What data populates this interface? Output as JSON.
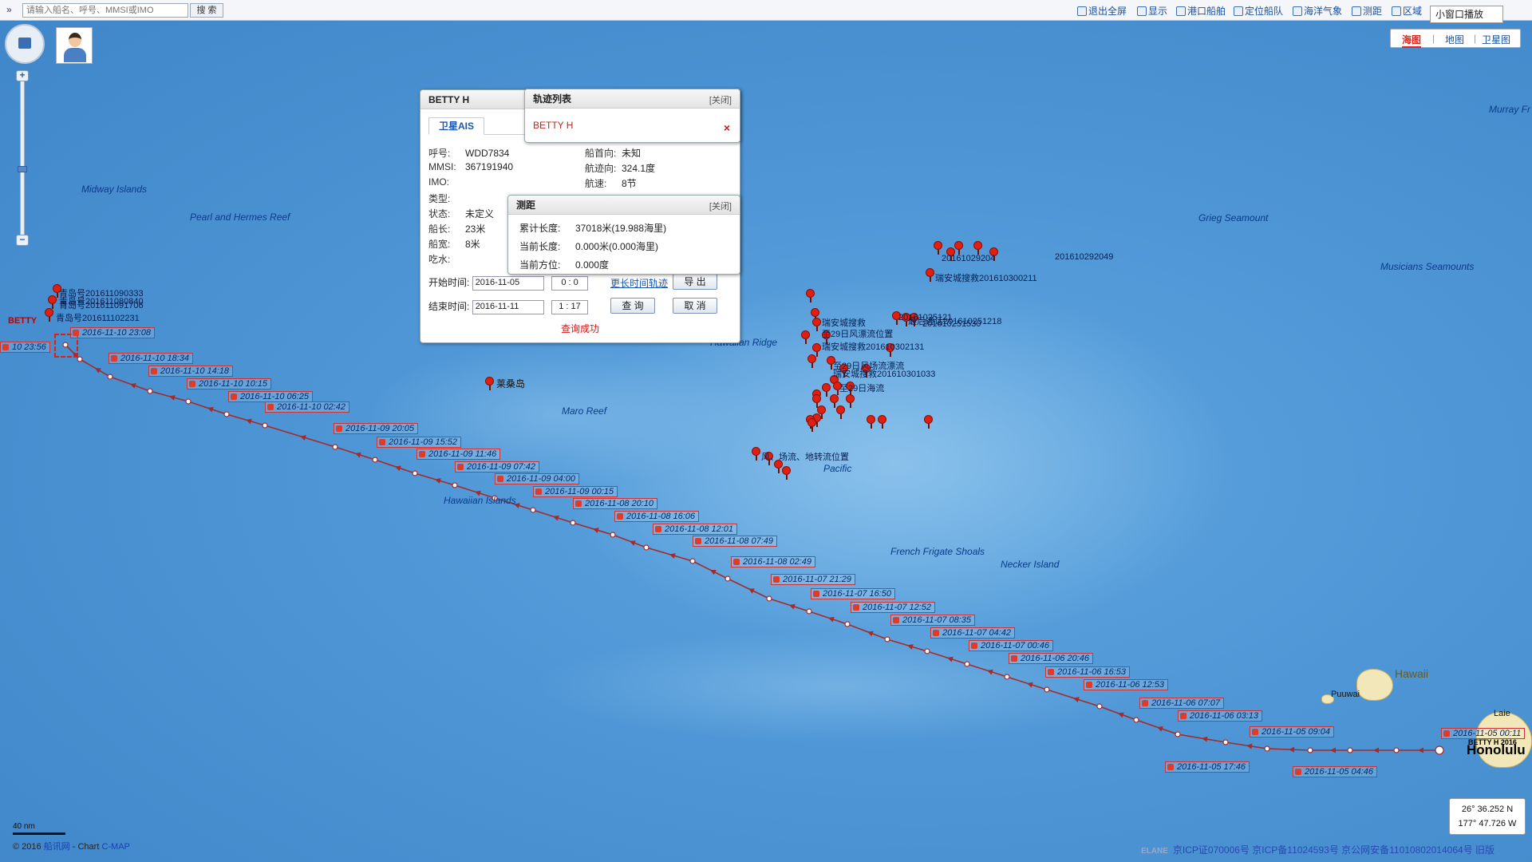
{
  "search": {
    "placeholder": "请输入船名、呼号、MMSI或IMO",
    "button": "搜 索",
    "collapse": "»"
  },
  "toolbar": [
    {
      "label": "退出全屏",
      "icon": "fullscreen-exit-icon"
    },
    {
      "label": "显示",
      "icon": "filter-icon"
    },
    {
      "label": "港口船舶",
      "icon": "port-icon"
    },
    {
      "label": "定位船队",
      "icon": "fleet-icon"
    },
    {
      "label": "海洋气象",
      "icon": "weather-icon"
    },
    {
      "label": "测距",
      "icon": "ruler-icon"
    },
    {
      "label": "区域",
      "icon": "area-icon"
    }
  ],
  "mini_window": "小窗口播放",
  "map_types": [
    "海图",
    "地图",
    "卫星图"
  ],
  "map_type_active": "海图",
  "colors": {
    "track": "#a52a2a",
    "pin": "#e01f10",
    "active_tab": "#e0261a",
    "link": "#1a55b0"
  },
  "places": [
    "Midway Islands",
    "Pearl and Hermes Reef",
    "Hawaiian Ridge",
    "Maro Reef",
    "Hawaiian Islands",
    "French Frigate Shoals",
    "Necker Island",
    "Grieg Seamount",
    "Musicians Seamounts",
    "Murray Fr",
    "Hawaii",
    "Puuwai",
    "Laie",
    "Honolulu",
    "莱桑岛",
    "Pacific"
  ],
  "ship_labels": {
    "start": "BETTY",
    "end": "BETTY H 2016"
  },
  "track_times": [
    "2016-11-10 23:08",
    "2016-11-10 18:34",
    "2016-11-10 14:18",
    "2016-11-10 10:15",
    "2016-11-10 06:25",
    "2016-11-10 02:42",
    "2016-11-09 20:05",
    "2016-11-09 15:52",
    "2016-11-09 11:46",
    "2016-11-09 07:42",
    "2016-11-09 04:00",
    "2016-11-09 00:15",
    "2016-11-08 20:10",
    "2016-11-08 16:06",
    "2016-11-08 12:01",
    "2016-11-08 07:49",
    "2016-11-08 02:49",
    "2016-11-07 21:29",
    "2016-11-07 16:50",
    "2016-11-07 12:52",
    "2016-11-07 08:35",
    "2016-11-07 04:42",
    "2016-11-07 00:46",
    "2016-11-06 20:46",
    "2016-11-06 16:53",
    "2016-11-06 12:53",
    "2016-11-06 07:07",
    "2016-11-06 03:13",
    "2016-11-05 09:04",
    "2016-11-05 17:46",
    "2016-11-05 04:46",
    "2016-11-05 00:11",
    "10 23:56"
  ],
  "pin_labels": {
    "west": [
      "青岛号201611090333",
      "青岛号201611091706",
      "青岛号201611102231",
      "青岛号201611080840"
    ],
    "north": [
      "瑞安城搜救201610300211",
      "20161029204",
      "瑞安城搜救",
      "20161025121",
      "至29日风漂流位置",
      "瑞安城搜救201610302131",
      "至29日风场流漂流",
      "瑞安城搜救201610301033",
      "至29日海流",
      "风、场流、地转流位置",
      "最后通话201610251218",
      "201610251530",
      "201610292049"
    ]
  },
  "info_panel": {
    "title": "BETTY H",
    "tab": "卫星AIS",
    "fields_left": [
      {
        "k": "呼号:",
        "v": "WDD7834"
      },
      {
        "k": "MMSI:",
        "v": "367191940"
      },
      {
        "k": "IMO:",
        "v": ""
      },
      {
        "k": "类型:",
        "v": ""
      },
      {
        "k": "状态:",
        "v": "未定义"
      },
      {
        "k": "船长:",
        "v": "23米"
      },
      {
        "k": "船宽:",
        "v": "8米"
      },
      {
        "k": "吃水:",
        "v": ""
      }
    ],
    "fields_right": [
      {
        "k": "船首向:",
        "v": "未知"
      },
      {
        "k": "航迹向:",
        "v": "324.1度"
      },
      {
        "k": "航速:",
        "v": "8节"
      }
    ],
    "start_label": "开始时间:",
    "start_date": "2016-11-05",
    "start_h": "0",
    "start_m": "0",
    "end_label": "结束时间:",
    "end_date": "2016-11-11",
    "end_h": "1",
    "end_m": "17",
    "long_track_link": "更长时间轨迹",
    "export": "导 出",
    "query": "查 询",
    "cancel": "取 消",
    "status": "查询成功"
  },
  "track_panel": {
    "title": "轨迹列表",
    "close": "[关闭]",
    "item": "BETTY H"
  },
  "measure_panel": {
    "title": "测距",
    "close": "[关闭]",
    "rows": [
      {
        "k": "累计长度:",
        "v": "37018米(19.988海里)"
      },
      {
        "k": "当前长度:",
        "v": "0.000米(0.000海里)"
      },
      {
        "k": "当前方位:",
        "v": "0.000度"
      }
    ]
  },
  "coords": {
    "lat": "26° 36.252 N",
    "lon": "177° 47.726 W"
  },
  "scale": "40 nm",
  "footer": {
    "copyright": "© 2016",
    "site": "船讯网",
    "sep": " - Chart ",
    "cmap": "C-MAP"
  },
  "icp": "京ICP证070006号 京ICP备11024593号 京公网安备11010802014064号 旧版",
  "elane": "ELANE"
}
